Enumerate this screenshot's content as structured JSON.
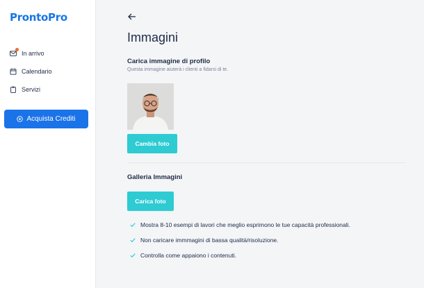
{
  "brand": {
    "name": "ProntoPro",
    "color": "#1976e6"
  },
  "sidebar": {
    "items": [
      {
        "label": "In arrivo",
        "icon": "mail-icon",
        "has_notification": true
      },
      {
        "label": "Calendario",
        "icon": "calendar-icon"
      },
      {
        "label": "Servizi",
        "icon": "clipboard-icon"
      }
    ],
    "buy_button": {
      "label": "Acquista Crediti",
      "icon": "plus-circle-icon",
      "color": "#1a73e8"
    }
  },
  "main": {
    "title": "Immagini",
    "profile": {
      "title": "Carica immagine di profilo",
      "subtitle": "Questa immagine aiuterà i clienti a fidarsi di te.",
      "change_button": "Cambia foto"
    },
    "gallery": {
      "title": "Galleria Immagini",
      "upload_button": "Carica foto",
      "tips": [
        "Mostra 8-10 esempi di lavori che meglio esprimono le tue capacità professionali.",
        "Non caricare immmagini di bassa qualità/risoluzione.",
        "Controlla come appaiono i contenuti."
      ]
    },
    "accent_color": "#2ecbd3"
  }
}
